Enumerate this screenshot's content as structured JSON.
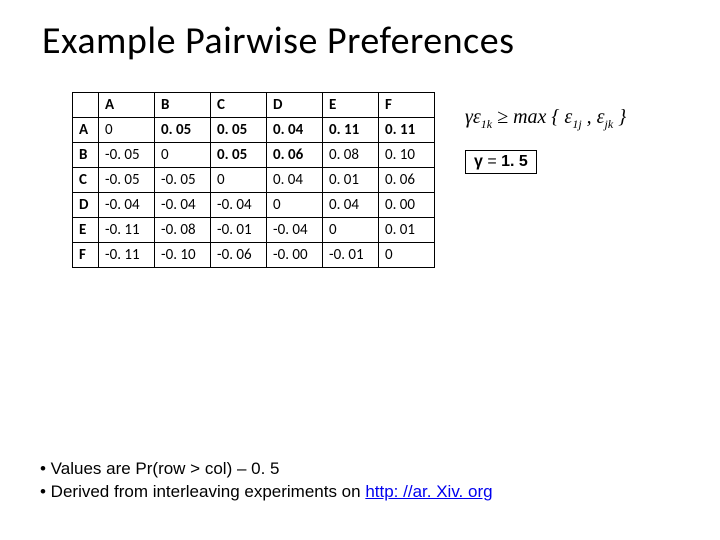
{
  "title": "Example Pairwise Preferences",
  "table": {
    "col_headers": [
      "A",
      "B",
      "C",
      "D",
      "E",
      "F"
    ],
    "row_headers": [
      "A",
      "B",
      "C",
      "D",
      "E",
      "F"
    ],
    "rows": [
      [
        "0",
        "0. 05",
        "0. 05",
        "0. 04",
        "0. 11",
        "0. 11"
      ],
      [
        "-0. 05",
        "0",
        "0. 05",
        "0. 06",
        "0. 08",
        "0. 10"
      ],
      [
        "-0. 05",
        "-0. 05",
        "0",
        "0. 04",
        "0. 01",
        "0. 06"
      ],
      [
        "-0. 04",
        "-0. 04",
        "-0. 04",
        "0",
        "0. 04",
        "0. 00"
      ],
      [
        "-0. 11",
        "-0. 08",
        "-0. 01",
        "-0. 04",
        "0",
        "0. 01"
      ],
      [
        "-0. 11",
        "-0. 10",
        "-0. 06",
        "-0. 00",
        "-0. 01",
        "0"
      ]
    ],
    "bold_map": [
      [
        false,
        true,
        true,
        true,
        true,
        true
      ],
      [
        false,
        false,
        true,
        true,
        false,
        false
      ],
      [
        false,
        false,
        false,
        false,
        false,
        false
      ],
      [
        false,
        false,
        false,
        false,
        false,
        false
      ],
      [
        false,
        false,
        false,
        false,
        false,
        false
      ],
      [
        false,
        false,
        false,
        false,
        false,
        false
      ]
    ]
  },
  "formula": {
    "text": "γε₁ₖ ≥ max { ε₁ⱼ , εⱼₖ }",
    "lhs_gamma": "γ",
    "lhs_eps": "ε",
    "lhs_sub": "1k",
    "geq": "≥",
    "max": "max",
    "inner_eps1": "ε",
    "inner_sub1": "1j",
    "inner_eps2": "ε",
    "inner_sub2": "jk"
  },
  "gamma_box": {
    "symbol": "γ",
    "eq": " = ",
    "value": "1. 5"
  },
  "bullets": {
    "b1_prefix": "• Values are Pr(row > col) – 0. 5",
    "b2_prefix": "• Derived from interleaving experiments on ",
    "b2_link_text": "http: //ar. Xiv. org",
    "b2_link_href": "http://arxiv.org"
  },
  "chart_data": {
    "type": "table",
    "title": "Example Pairwise Preferences",
    "row_labels": [
      "A",
      "B",
      "C",
      "D",
      "E",
      "F"
    ],
    "col_labels": [
      "A",
      "B",
      "C",
      "D",
      "E",
      "F"
    ],
    "values": [
      [
        0.0,
        0.05,
        0.05,
        0.04,
        0.11,
        0.11
      ],
      [
        -0.05,
        0.0,
        0.05,
        0.06,
        0.08,
        0.1
      ],
      [
        -0.05,
        -0.05,
        0.0,
        0.04,
        0.01,
        0.06
      ],
      [
        -0.04,
        -0.04,
        -0.04,
        0.0,
        0.04,
        0.0
      ],
      [
        -0.11,
        -0.08,
        -0.01,
        -0.04,
        0.0,
        0.01
      ],
      [
        -0.11,
        -0.1,
        -0.06,
        0.0,
        -0.01,
        0.0
      ]
    ],
    "note": "Values are Pr(row > col) - 0.5; γ = 1.5"
  }
}
